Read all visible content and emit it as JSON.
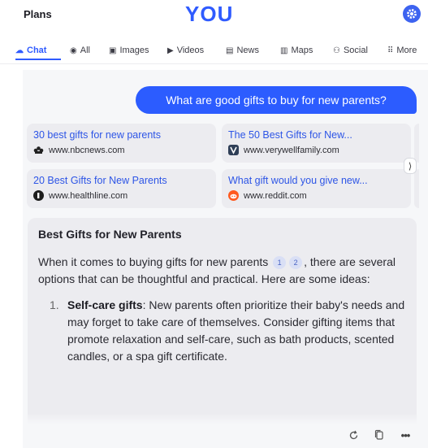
{
  "header": {
    "plans_label": "Plans",
    "logo_text": "YOU",
    "logo_mark": "™",
    "settings_icon": "gear-icon",
    "accent_color": "#2f5bff"
  },
  "tabs": [
    {
      "label": "Chat",
      "icon": "chat-icon"
    },
    {
      "label": "All",
      "icon": "search-icon"
    },
    {
      "label": "Images",
      "icon": "image-icon"
    },
    {
      "label": "Videos",
      "icon": "play-icon"
    },
    {
      "label": "News",
      "icon": "news-icon"
    },
    {
      "label": "Maps",
      "icon": "map-icon"
    },
    {
      "label": "Social",
      "icon": "people-icon"
    },
    {
      "label": "More",
      "icon": "grid-icon"
    }
  ],
  "user_message": "What are good gifts to buy for new parents?",
  "sources": [
    {
      "title": "30 best gifts for new parents",
      "site": "www.nbcnews.com",
      "favicon": "nbc-icon"
    },
    {
      "title": "The 50 Best Gifts for New...",
      "site": "www.verywellfamily.com",
      "favicon": "verywell-icon"
    },
    {
      "title": "20 Best Gifts for New Parents",
      "site": "www.healthline.com",
      "favicon": "healthline-icon"
    },
    {
      "title": "What gift would you give new...",
      "site": "www.reddit.com",
      "favicon": "reddit-icon"
    }
  ],
  "sources_next": "⟩",
  "answer": {
    "title": "Best Gifts for New Parents",
    "intro_before": "When it comes to buying gifts for new parents",
    "citations": [
      "1",
      "2"
    ],
    "intro_after": ", there are several options that can be thoughtful and practical. Here are some ideas:",
    "items": [
      {
        "num": "1.",
        "term": "Self-care gifts",
        "text": ": New parents often prioritize their baby's needs and may forget to take care of themselves. Consider gifting items that promote relaxation and self-care, such as bath products, scented candles, or a spa gift certificate."
      }
    ]
  },
  "actions": {
    "regenerate": "refresh-icon",
    "copy": "copy-icon",
    "more": "•••"
  }
}
